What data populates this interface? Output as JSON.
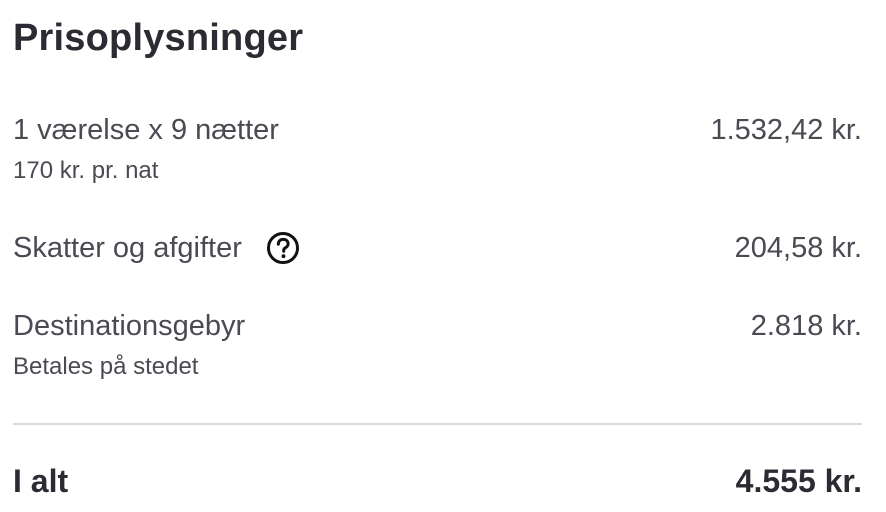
{
  "title": "Prisoplysninger",
  "rows": [
    {
      "label": "1 værelse x 9 nætter",
      "sublabel": "170 kr. pr. nat",
      "amount": "1.532,42 kr."
    },
    {
      "label": "Skatter og afgifter",
      "amount": "204,58 kr.",
      "icon": "help-circle-icon"
    },
    {
      "label": "Destinationsgebyr",
      "sublabel": "Betales på stedet",
      "amount": "2.818 kr."
    }
  ],
  "total": {
    "label": "I alt",
    "amount": "4.555 kr."
  }
}
